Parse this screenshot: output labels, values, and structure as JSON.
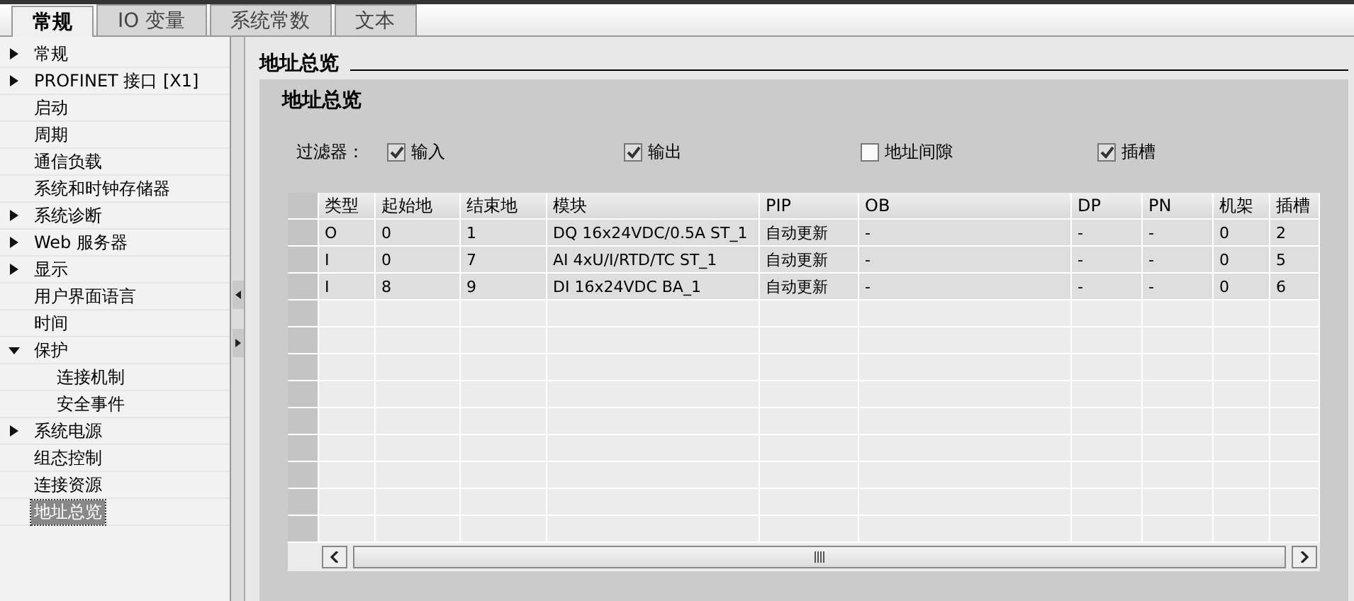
{
  "tabs": [
    {
      "label": "常规",
      "selected": true
    },
    {
      "label": "IO 变量",
      "selected": false
    },
    {
      "label": "系统常数",
      "selected": false
    },
    {
      "label": "文本",
      "selected": false
    }
  ],
  "sidebar": {
    "items": [
      {
        "label": "常规",
        "expanded": false,
        "selected": false
      },
      {
        "label": "PROFINET 接口 [X1]",
        "expanded": false,
        "selected": false
      },
      {
        "label": "启动",
        "selected": false
      },
      {
        "label": "周期",
        "selected": false
      },
      {
        "label": "通信负载",
        "selected": false
      },
      {
        "label": "系统和时钟存储器",
        "selected": false
      },
      {
        "label": "系统诊断",
        "expanded": false,
        "selected": false
      },
      {
        "label": "Web 服务器",
        "expanded": false,
        "selected": false
      },
      {
        "label": "显示",
        "expanded": false,
        "selected": false
      },
      {
        "label": "用户界面语言",
        "selected": false
      },
      {
        "label": "时间",
        "selected": false
      },
      {
        "label": "保护",
        "expanded": true,
        "selected": false,
        "children": [
          {
            "label": "连接机制",
            "selected": false
          },
          {
            "label": "安全事件",
            "selected": false
          }
        ]
      },
      {
        "label": "系统电源",
        "expanded": false,
        "selected": false
      },
      {
        "label": "组态控制",
        "selected": false
      },
      {
        "label": "连接资源",
        "selected": false
      },
      {
        "label": "地址总览",
        "selected": true
      }
    ]
  },
  "section_title": "地址总览",
  "panel": {
    "title": "地址总览",
    "filter_label": "过滤器：",
    "filters": [
      {
        "label": "输入",
        "checked": true
      },
      {
        "label": "输出",
        "checked": true
      },
      {
        "label": "地址间隙",
        "checked": false
      },
      {
        "label": "插槽",
        "checked": true
      }
    ],
    "table": {
      "columns": [
        "类型",
        "起始地",
        "结束地",
        "模块",
        "PIP",
        "OB",
        "DP",
        "PN",
        "机架",
        "插槽"
      ],
      "rows": [
        [
          "O",
          "0",
          "1",
          "DQ 16x24VDC/0.5A ST_1",
          "自动更新",
          "-",
          "-",
          "-",
          "0",
          "2"
        ],
        [
          "I",
          "0",
          "7",
          "AI 4xU/I/RTD/TC ST_1",
          "自动更新",
          "-",
          "-",
          "-",
          "0",
          "5"
        ],
        [
          "I",
          "8",
          "9",
          "DI 16x24VDC BA_1",
          "自动更新",
          "-",
          "-",
          "-",
          "0",
          "6"
        ]
      ]
    }
  }
}
